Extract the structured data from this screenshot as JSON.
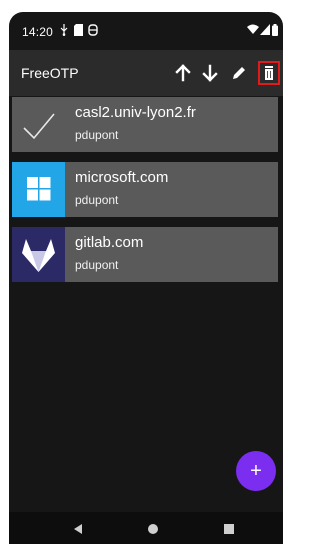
{
  "status_bar": {
    "time": "14:20",
    "icons": [
      "usb-icon",
      "sd-card-icon",
      "settings-ring-icon",
      "wifi-icon",
      "signal-icon",
      "battery-icon"
    ]
  },
  "app_bar": {
    "title": "FreeOTP",
    "actions": [
      {
        "name": "move-up",
        "icon": "arrow-up-icon"
      },
      {
        "name": "move-down",
        "icon": "arrow-down-icon"
      },
      {
        "name": "edit",
        "icon": "pencil-icon"
      },
      {
        "name": "delete",
        "icon": "trash-icon",
        "highlighted": true
      }
    ],
    "highlight_color": "#e11b1b"
  },
  "tokens": [
    {
      "issuer": "casl2.univ-lyon2.fr",
      "account": "pdupont",
      "logo": "checkmark-icon",
      "logo_bg": "#5a5a5a"
    },
    {
      "issuer": "microsoft.com",
      "account": "pdupont",
      "logo": "windows-icon",
      "logo_bg": "#23a6e8"
    },
    {
      "issuer": "gitlab.com",
      "account": "pdupont",
      "logo": "gitlab-fox-icon",
      "logo_bg": "#2b2a66"
    }
  ],
  "fab": {
    "label": "+",
    "icon": "add-icon",
    "color": "#7c2ef0"
  },
  "nav_bar": {
    "icons": [
      "back-icon",
      "home-icon",
      "recents-icon"
    ]
  }
}
